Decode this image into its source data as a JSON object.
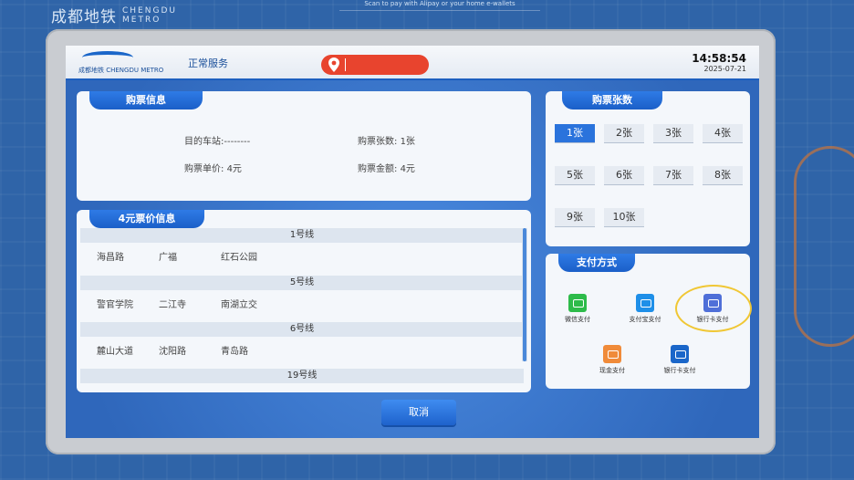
{
  "brand": {
    "name_cn": "成都地铁",
    "name_en_1": "CHENGDU",
    "name_en_2": "METRO"
  },
  "banner": "Scan to pay with Alipay or your home e-wallets",
  "header": {
    "logo_text": "成都地铁 CHENGDU METRO",
    "service_status": "正常服务",
    "time": "14:58:54",
    "date": "2025-07-21"
  },
  "ticket_info": {
    "title": "购票信息",
    "destination_label": "目的车站:",
    "destination_value": "--------",
    "qty_label": "购票张数:",
    "qty_value": "1张",
    "unit_price_label": "购票单价:",
    "unit_price_value": "4元",
    "total_label": "购票金额:",
    "total_value": "4元"
  },
  "fare_info": {
    "title": "4元票价信息",
    "lines": [
      {
        "name": "1号线",
        "stations": [
          "海昌路",
          "广福",
          "红石公园"
        ]
      },
      {
        "name": "5号线",
        "stations": [
          "警官学院",
          "二江寺",
          "南湖立交"
        ]
      },
      {
        "name": "6号线",
        "stations": [
          "麓山大道",
          "沈阳路",
          "青岛路"
        ]
      },
      {
        "name": "19号线",
        "stations": []
      }
    ]
  },
  "quantity": {
    "title": "购票张数",
    "options": [
      "1张",
      "2张",
      "3张",
      "4张",
      "5张",
      "6张",
      "7张",
      "8张",
      "9张",
      "10张"
    ],
    "selected": "1张"
  },
  "payment": {
    "title": "支付方式",
    "options": [
      {
        "label": "微信支付",
        "color": "#2dbb4a"
      },
      {
        "label": "支付宝支付",
        "color": "#1e8fe8"
      },
      {
        "label": "银行卡支付",
        "color": "#4f6fd8"
      },
      {
        "label": "现金支付",
        "color": "#f08b3a"
      },
      {
        "label": "银行卡支付",
        "color": "#1a66c9"
      }
    ]
  },
  "cancel_label": "取消",
  "colors": {
    "accent": "#1b5fc8",
    "highlight": "#f0c735",
    "location": "#e8442e"
  }
}
